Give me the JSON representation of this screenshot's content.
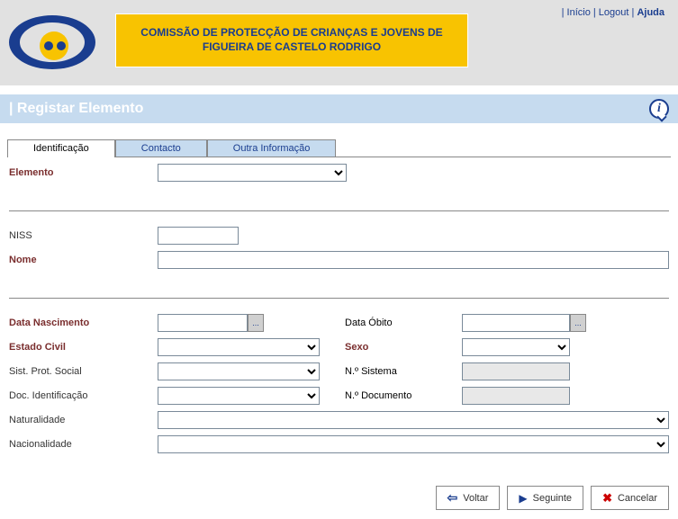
{
  "header": {
    "banner_line1": "COMISSÃO DE PROTECÇÃO DE CRIANÇAS E JOVENS DE",
    "banner_line2": "FIGUEIRA DE CASTELO RODRIGO",
    "links": {
      "inicio": "Início",
      "logout": "Logout",
      "ajuda": "Ajuda"
    }
  },
  "title": "| Registar Elemento",
  "tabs": {
    "identificacao": "Identificação",
    "contacto": "Contacto",
    "outra": "Outra Informação"
  },
  "labels": {
    "elemento": "Elemento",
    "niss": "NISS",
    "nome": "Nome",
    "data_nascimento": "Data Nascimento",
    "data_obito": "Data Óbito",
    "estado_civil": "Estado Civil",
    "sexo": "Sexo",
    "sist_prot_social": "Sist. Prot. Social",
    "n_sistema": "N.º Sistema",
    "doc_identificacao": "Doc. Identificação",
    "n_documento": "N.º Documento",
    "naturalidade": "Naturalidade",
    "nacionalidade": "Nacionalidade"
  },
  "values": {
    "elemento": "",
    "niss": "",
    "nome": "",
    "data_nascimento": "",
    "data_obito": "",
    "estado_civil": "",
    "sexo": "",
    "sist_prot_social": "",
    "n_sistema": "",
    "doc_identificacao": "",
    "n_documento": "",
    "naturalidade": "",
    "nacionalidade": ""
  },
  "buttons": {
    "voltar": "Voltar",
    "seguinte": "Seguinte",
    "cancelar": "Cancelar"
  },
  "date_picker_glyph": "..."
}
